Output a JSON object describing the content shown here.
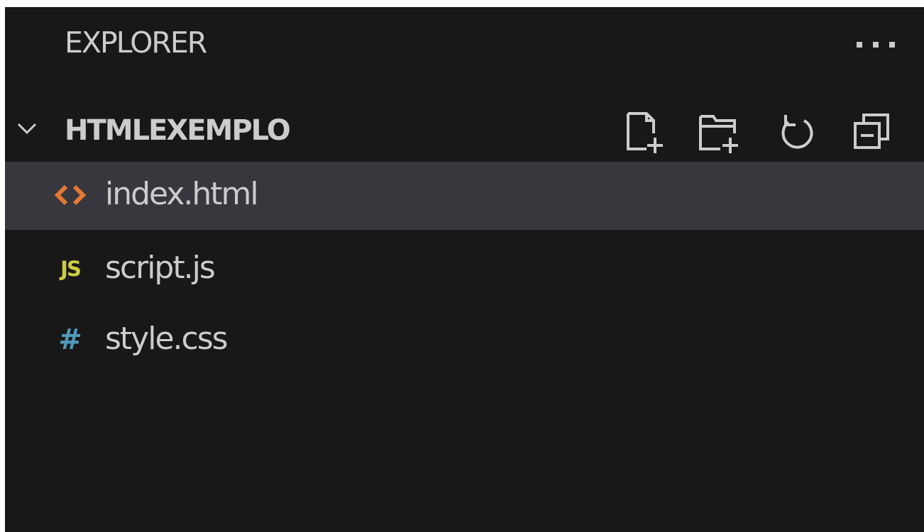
{
  "explorer": {
    "title": "EXPLORER",
    "more_actions_icon": "ellipsis-icon"
  },
  "folder": {
    "name": "HTMLEXEMPLO",
    "expanded": true,
    "actions": [
      {
        "icon": "new-file-icon"
      },
      {
        "icon": "new-folder-icon"
      },
      {
        "icon": "refresh-icon"
      },
      {
        "icon": "collapse-all-icon"
      }
    ]
  },
  "files": [
    {
      "name": "index.html",
      "icon": "html-file-icon",
      "color": "#e37933",
      "selected": true
    },
    {
      "name": "script.js",
      "icon": "js-file-icon",
      "badge": "JS",
      "color": "#cbcb41",
      "selected": false
    },
    {
      "name": "style.css",
      "icon": "css-file-icon",
      "badge": "#",
      "color": "#519aba",
      "selected": false
    }
  ],
  "colors": {
    "background": "#181818",
    "selected_row": "#37373d",
    "text": "#cccccc"
  }
}
